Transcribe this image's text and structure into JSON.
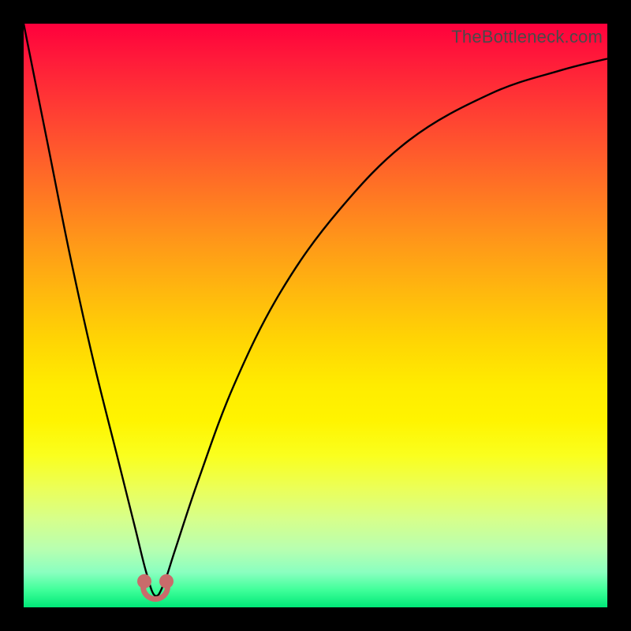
{
  "watermark": "TheBottleneck.com",
  "colors": {
    "frame": "#000000",
    "curve": "#000000",
    "marker": "#c96b6b"
  },
  "chart_data": {
    "type": "line",
    "title": "",
    "xlabel": "",
    "ylabel": "",
    "xlim": [
      0,
      100
    ],
    "ylim": [
      0,
      100
    ],
    "grid": false,
    "legend": false,
    "background_gradient": [
      "#ff003c",
      "#ffec00",
      "#00e878"
    ],
    "series": [
      {
        "name": "bottleneck-curve",
        "x": [
          0,
          4,
          8,
          12,
          16,
          19,
          21,
          22.5,
          24,
          26,
          30,
          36,
          44,
          54,
          66,
          80,
          92,
          100
        ],
        "values": [
          100,
          80,
          60,
          42,
          26,
          14,
          6,
          2,
          4,
          10,
          22,
          38,
          54,
          68,
          80,
          88,
          92,
          94
        ]
      }
    ],
    "minimum_marker": {
      "x": 22.5,
      "value": 2
    },
    "annotations": []
  }
}
